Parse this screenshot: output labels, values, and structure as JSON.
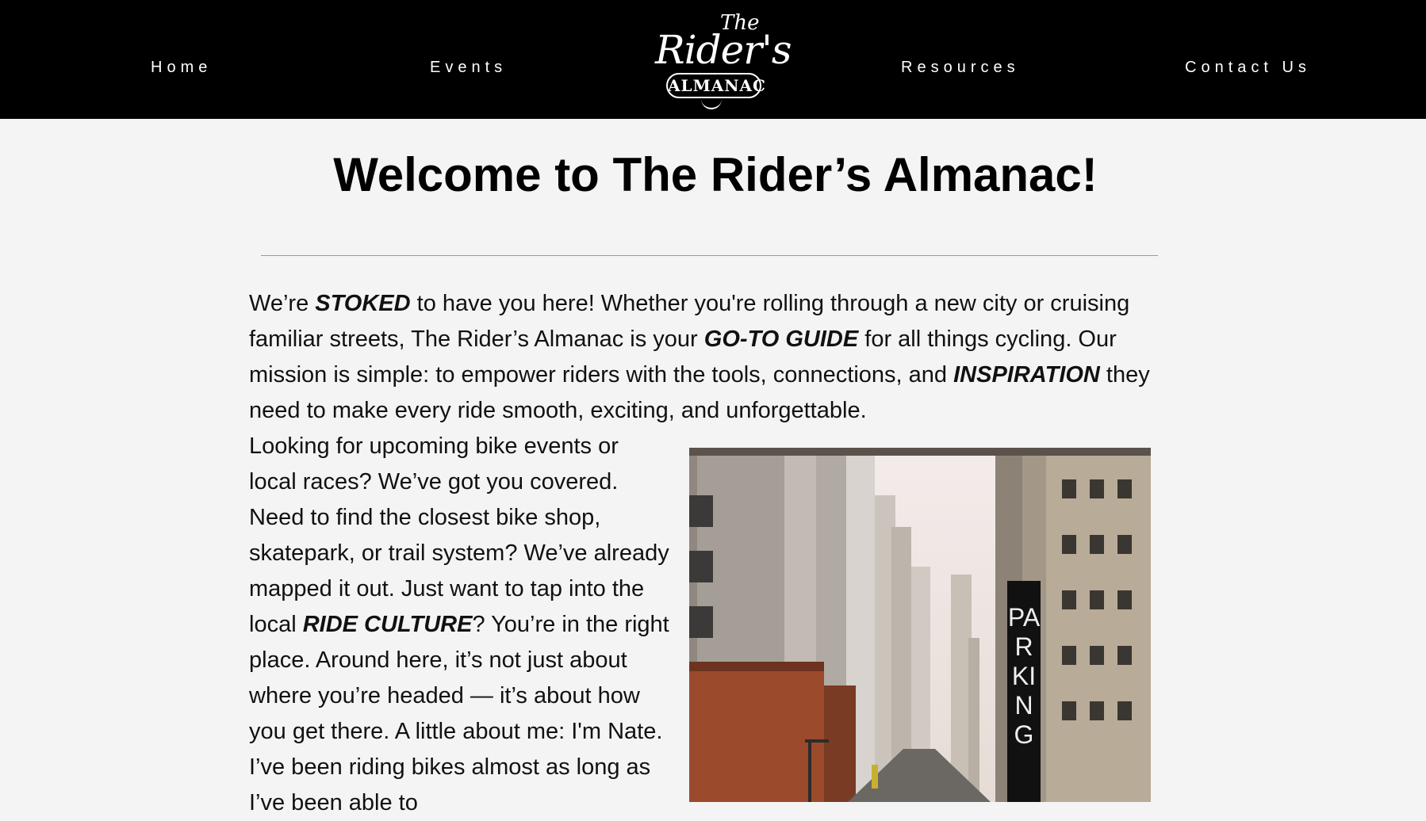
{
  "nav": {
    "home": "Home",
    "events": "Events",
    "resources": "Resources",
    "contact": "Contact Us"
  },
  "logo": {
    "the": "The",
    "riders": "Rider's",
    "almanac": "ALMANAC"
  },
  "main": {
    "title": "Welcome to The Rider’s Almanac!",
    "intro": {
      "p1_a": "We’re ",
      "stoked": "STOKED",
      "p1_b": " to have you here! Whether you're rolling through a new city or cruising familiar streets, The Rider’s Almanac is your ",
      "goto": "GO-TO GUIDE",
      "p1_c": " for all things cycling. Our mission is simple: to empower riders with the tools, connections, and ",
      "inspiration": "INSPIRATION",
      "p1_d": " they need to make every ride smooth, exciting, and unforgettable."
    },
    "body": {
      "p2_a": "Looking for upcoming bike events or local races? We’ve got you covered. Need to find the closest bike shop, skatepark, or trail system? We’ve already mapped it out. Just want to tap into the local ",
      "ride_culture": "RIDE CULTURE",
      "p2_b": "? You’re in the right place. Around here, it’s not just about where you’re headed — it’s about how you get there. A little about me: I'm Nate. I’ve been riding bikes almost as long as I’ve been able to"
    },
    "photo": {
      "sign_text": "PARKING"
    }
  }
}
